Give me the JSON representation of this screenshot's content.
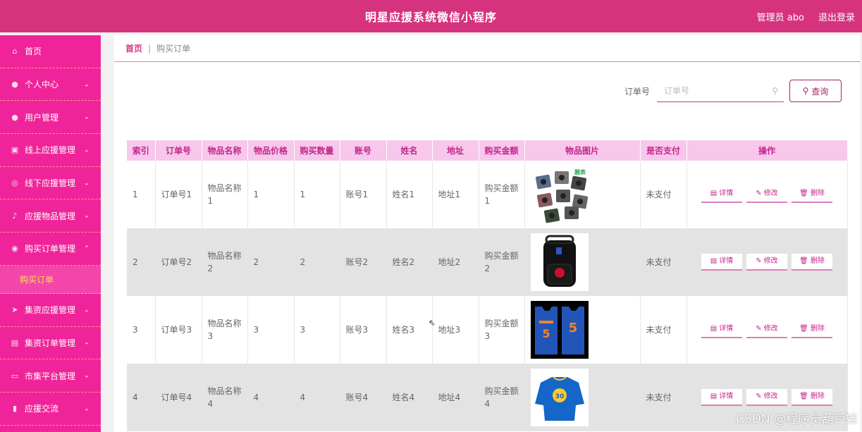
{
  "header": {
    "title": "明星应援系统微信小程序",
    "user": "管理员 abo",
    "logout": "退出登录"
  },
  "sidebar": {
    "items": [
      {
        "label": "首页",
        "icon": "home-icon",
        "glyph": "⌂",
        "chevron": ""
      },
      {
        "label": "个人中心",
        "icon": "user-icon",
        "glyph": "●",
        "chevron": "⌄"
      },
      {
        "label": "用户管理",
        "icon": "user-icon",
        "glyph": "●",
        "chevron": "⌄"
      },
      {
        "label": "线上应援管理",
        "icon": "clipboard-icon",
        "glyph": "▣",
        "chevron": "⌄"
      },
      {
        "label": "线下应援管理",
        "icon": "compass-icon",
        "glyph": "◎",
        "chevron": "⌄"
      },
      {
        "label": "应援物品管理",
        "icon": "microphone-icon",
        "glyph": "♪",
        "chevron": "⌄"
      },
      {
        "label": "购买订单管理",
        "icon": "cart-icon",
        "glyph": "◉",
        "chevron": "⌃"
      }
    ],
    "sub_active": "购买订单",
    "items_after": [
      {
        "label": "集资应援管理",
        "icon": "send-icon",
        "glyph": "➤",
        "chevron": "⌄"
      },
      {
        "label": "集资订单管理",
        "icon": "image-icon",
        "glyph": "▤",
        "chevron": "⌄"
      },
      {
        "label": "市集平台管理",
        "icon": "store-icon",
        "glyph": "▭",
        "chevron": "⌄"
      },
      {
        "label": "应援交流",
        "icon": "chart-icon",
        "glyph": "▮",
        "chevron": "⌄"
      }
    ]
  },
  "breadcrumb": {
    "home": "首页",
    "sep": "|",
    "current": "购买订单"
  },
  "search": {
    "label": "订单号",
    "placeholder": "订单号",
    "button": "查询"
  },
  "table": {
    "headers": [
      "索引",
      "订单号",
      "物品名称",
      "物品价格",
      "购买数量",
      "账号",
      "姓名",
      "地址",
      "购买金额",
      "物品图片",
      "是否支付",
      "操作"
    ],
    "rows": [
      {
        "idx": "1",
        "order": "订单号1",
        "name": "物品名称1",
        "price": "1",
        "qty": "1",
        "account": "账号1",
        "person": "姓名1",
        "addr": "地址1",
        "amount": "购买金额1",
        "image": "badges-image",
        "paid": "未支付"
      },
      {
        "idx": "2",
        "order": "订单号2",
        "name": "物品名称2",
        "price": "2",
        "qty": "2",
        "account": "账号2",
        "person": "姓名2",
        "addr": "地址2",
        "amount": "购买金额2",
        "image": "backpack-image",
        "paid": "未支付"
      },
      {
        "idx": "3",
        "order": "订单号3",
        "name": "物品名称3",
        "price": "3",
        "qty": "3",
        "account": "账号3",
        "person": "姓名3",
        "addr": "地址3",
        "amount": "购买金额3",
        "image": "jersey-image",
        "paid": "未支付"
      },
      {
        "idx": "4",
        "order": "订单号4",
        "name": "物品名称4",
        "price": "4",
        "qty": "4",
        "account": "账号4",
        "person": "姓名4",
        "addr": "地址4",
        "amount": "购买金额4",
        "image": "sweater-image",
        "paid": "未支付"
      }
    ],
    "ops": {
      "detail": "详情",
      "edit": "修改",
      "delete": "删除"
    }
  },
  "image_text": {
    "jersey_number": "5",
    "sweater_number": "30",
    "badge_text": "腕表"
  },
  "watermark": "CSDN @程序员葫芦娃",
  "colors": {
    "primary": "#d6337f",
    "sidebar": "#f0249a",
    "accent": "#ffe14d",
    "table_header": "#f7c8ec"
  }
}
